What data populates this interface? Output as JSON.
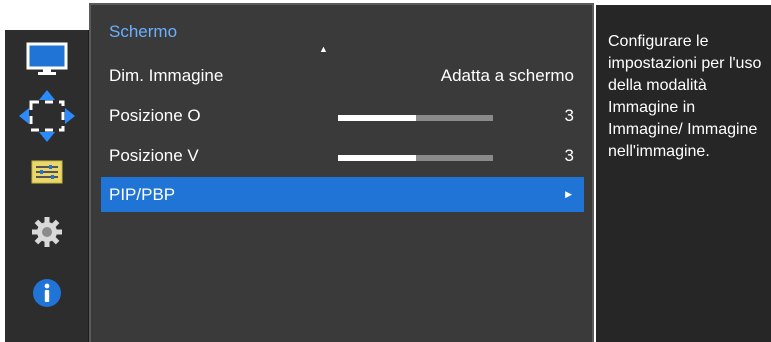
{
  "menu": {
    "title": "Schermo",
    "rows": [
      {
        "label": "Dim. Immagine",
        "value": "Adatta a schermo"
      },
      {
        "label": "Posizione O",
        "value": "3",
        "level": 0.5
      },
      {
        "label": "Posizione V",
        "value": "3",
        "level": 0.5
      },
      {
        "label": "PIP/PBP"
      }
    ]
  },
  "description": "Configurare le impostazioni per l'uso della modalità Immagine in Immagine/ Immagine nell'immagine.",
  "icons": [
    "monitor-icon",
    "position-arrows-icon",
    "settings-sliders-icon",
    "gear-icon",
    "info-icon"
  ],
  "colors": {
    "accent": "#1f74d6",
    "title": "#6ab0ff",
    "panel": "#3a3a3a",
    "rail": "#2d2d2d"
  }
}
